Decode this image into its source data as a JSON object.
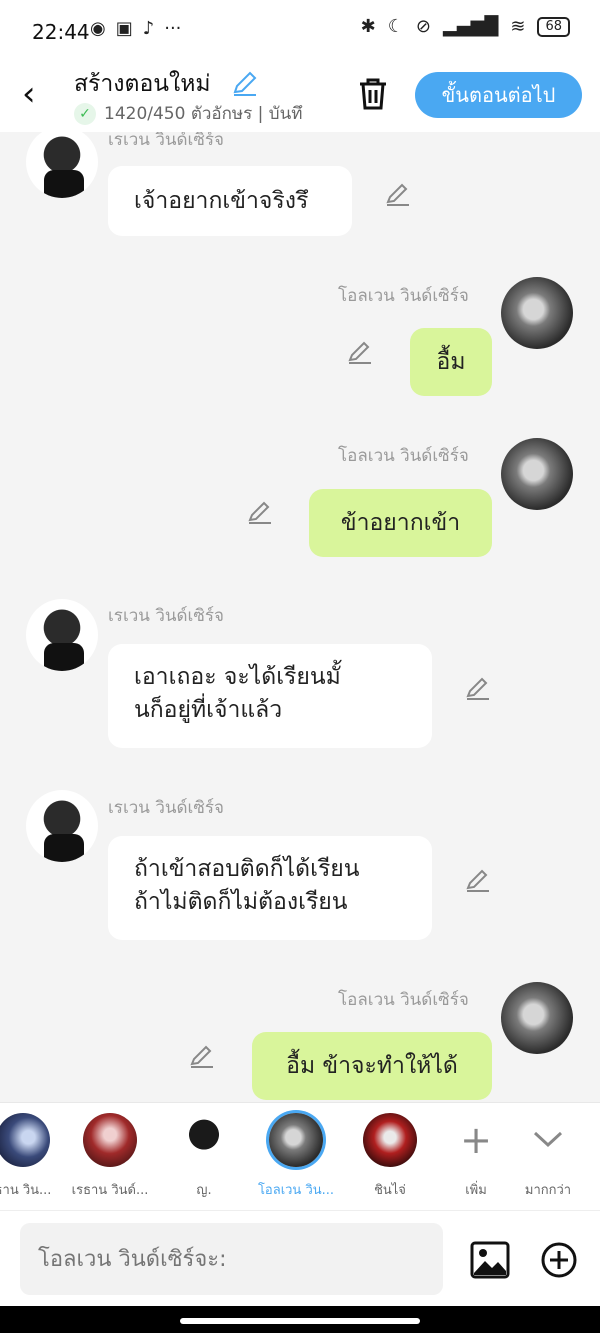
{
  "status": {
    "time": "22:44",
    "battery": "68"
  },
  "header": {
    "title": "สร้างตอนใหม่",
    "count": "1420/450 ตัวอักษร | บันทึ",
    "next": "ขั้นตอนต่อไป"
  },
  "messages": [
    {
      "side": "left",
      "name": "เรเวน วินด์เซิร์จ",
      "text": "เจ้าอยากเข้าจริงรึ"
    },
    {
      "side": "right",
      "name": "โอลเวน วินด์เซิร์จ",
      "text": "อื้ม"
    },
    {
      "side": "right",
      "name": "โอลเวน วินด์เซิร์จ",
      "text": "ข้าอยากเข้า"
    },
    {
      "side": "left",
      "name": "เรเวน วินด์เซิร์จ",
      "text": "เอาเถอะ จะได้เรียนมั้\nนก็อยู่ที่เจ้าแล้ว"
    },
    {
      "side": "left",
      "name": "เรเวน วินด์เซิร์จ",
      "text": "ถ้าเข้าสอบติดก็ได้เรียน\nถ้าไม่ติดก็ไม่ต้องเรียน"
    },
    {
      "side": "right",
      "name": "โอลเวน วินด์เซิร์จ",
      "text": "อื้ม ข้าจะทำให้ได้"
    }
  ],
  "characters": [
    {
      "label": "ธาน วิน...",
      "active": false
    },
    {
      "label": "เรธาน วินด์...",
      "active": false
    },
    {
      "label": "ญ.",
      "active": false
    },
    {
      "label": "โอลเวน วิน...",
      "active": true
    },
    {
      "label": "ชินไจ่",
      "active": false
    },
    {
      "label": "เพิ่ม",
      "active": false
    },
    {
      "label": "มากกว่า",
      "active": false
    }
  ],
  "input": {
    "placeholder": "โอลเวน วินด์เซิร์จะ:"
  },
  "colors": {
    "accent": "#4aa8f2",
    "green_bubble": "#d9f59b",
    "check_green": "#3cbb53"
  }
}
